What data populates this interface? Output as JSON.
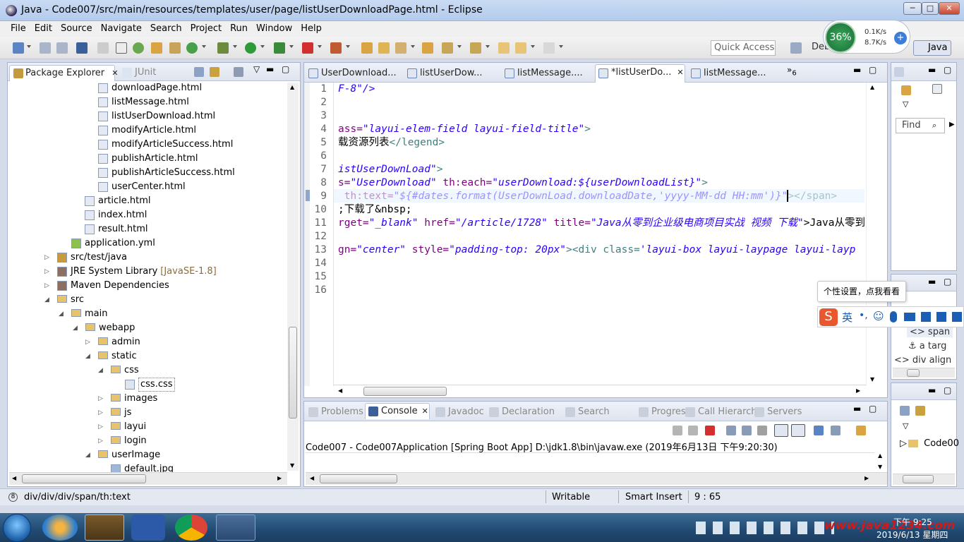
{
  "window": {
    "title": "Java - Code007/src/main/resources/templates/user/page/listUserDownloadPage.html - Eclipse",
    "buttons": [
      "─",
      "□",
      "✕"
    ]
  },
  "menu": [
    "File",
    "Edit",
    "Source",
    "Navigate",
    "Search",
    "Project",
    "Run",
    "Window",
    "Help"
  ],
  "toolbar": {
    "quick_access": "Quick Access",
    "perspective_java": "Java",
    "perspective_debug": "Debug",
    "net_meter": {
      "percent": "36%",
      "up": "0.1K/s",
      "down": "8.7K/s"
    }
  },
  "package_explorer": {
    "tab_label": "Package Explorer",
    "junit_tab": "JUnit",
    "items": [
      {
        "label": "downloadPage.html"
      },
      {
        "label": "listMessage.html"
      },
      {
        "label": "listUserDownload.html"
      },
      {
        "label": "modifyArticle.html"
      },
      {
        "label": "modifyArticleSuccess.html"
      },
      {
        "label": "publishArticle.html"
      },
      {
        "label": "publishArticleSuccess.html"
      },
      {
        "label": "userCenter.html"
      },
      {
        "label": "article.html"
      },
      {
        "label": "index.html"
      },
      {
        "label": "result.html"
      },
      {
        "label": "application.yml"
      },
      {
        "label": "src/test/java"
      },
      {
        "label": "JRE System Library",
        "suffix": "[JavaSE-1.8]"
      },
      {
        "label": "Maven Dependencies"
      },
      {
        "label": "src"
      },
      {
        "label": "main"
      },
      {
        "label": "webapp"
      },
      {
        "label": "admin"
      },
      {
        "label": "static"
      },
      {
        "label": "css"
      },
      {
        "label": "css.css"
      },
      {
        "label": "images"
      },
      {
        "label": "js"
      },
      {
        "label": "layui"
      },
      {
        "label": "login"
      },
      {
        "label": "userImage"
      },
      {
        "label": "default.jpg"
      }
    ]
  },
  "editor": {
    "tabs": [
      "UserDownload...",
      "listUserDow...",
      "listMessage....",
      "*listUserDo...",
      "listMessage..."
    ],
    "overflow_count": "6",
    "line_numbers": [
      "1",
      "2",
      "3",
      "4",
      "5",
      "6",
      "7",
      "8",
      "9",
      "10",
      "11",
      "12",
      "13",
      "14",
      "15",
      "16"
    ],
    "lines": [
      [
        {
          "t": "F-8\"/>",
          "c": "str"
        }
      ],
      [],
      [],
      [
        {
          "t": "ass=",
          "c": "attr"
        },
        {
          "t": "\"layui-elem-field layui-field-title\"",
          "c": "str"
        },
        {
          "t": ">",
          "c": "tag"
        }
      ],
      [
        {
          "t": "载资源列表",
          "c": "plain"
        },
        {
          "t": "</legend>",
          "c": "tag"
        }
      ],
      [],
      [
        {
          "t": "istUserDownLoad\"",
          "c": "str"
        },
        {
          "t": ">",
          "c": "tag"
        }
      ],
      [
        {
          "t": "s=",
          "c": "attr"
        },
        {
          "t": "\"UserDownload\"",
          "c": "str"
        },
        {
          "t": " th:each=",
          "c": "attr"
        },
        {
          "t": "\"userDownload:${userDownloadList}\"",
          "c": "str"
        },
        {
          "t": ">",
          "c": "tag"
        }
      ],
      [
        {
          "t": " th:text=",
          "c": "attr"
        },
        {
          "t": "\"${#dates.format(UserDownLoad.downloadDate,'yyyy-MM-dd HH:mm')}\"",
          "c": "str"
        },
        {
          "t": "></",
          "c": "tag"
        },
        {
          "t": "span",
          "c": "tag"
        },
        {
          "t": ">",
          "c": "tag"
        }
      ],
      [
        {
          "t": ";下载了&nbsp;",
          "c": "plain"
        }
      ],
      [
        {
          "t": "rget=",
          "c": "attr"
        },
        {
          "t": "\"_blank\"",
          "c": "str"
        },
        {
          "t": " href=",
          "c": "attr"
        },
        {
          "t": "\"/article/1728\"",
          "c": "str"
        },
        {
          "t": " title=",
          "c": "attr"
        },
        {
          "t": "\"Java从零到企业级电商项目实战 视频 下载\"",
          "c": "str"
        },
        {
          "t": ">Java从零到企业级电",
          "c": "plain"
        }
      ],
      [],
      [
        {
          "t": "gn=",
          "c": "attr"
        },
        {
          "t": "\"center\"",
          "c": "str"
        },
        {
          "t": " style=",
          "c": "attr"
        },
        {
          "t": "\"padding-top: 20px\"",
          "c": "str"
        },
        {
          "t": "><div class=",
          "c": "tag"
        },
        {
          "t": "'layui-box layui-laypage layui-layp",
          "c": "str"
        }
      ],
      [],
      [],
      []
    ]
  },
  "right_panel": {
    "find_placeholder": "Find",
    "outline_items": [
      "span",
      "a targ",
      "div align"
    ],
    "bottom_item": "Code00"
  },
  "console": {
    "tabs": [
      "Problems",
      "Console",
      "Javadoc",
      "Declaration",
      "Search",
      "Progress",
      "Call Hierarchy",
      "Servers"
    ],
    "header": "Code007 - Code007Application [Spring Boot App] D:\\jdk1.8\\bin\\javaw.exe (2019年6月13日 下午9:20:30)"
  },
  "ime_bar": {
    "tooltip": "个性设置，点我看看",
    "lang": "英"
  },
  "status": {
    "path": "div/div/div/span/th:text",
    "writable": "Writable",
    "insert_mode": "Smart Insert",
    "position": "9 : 65"
  },
  "taskbar": {
    "time": "下午 9:25",
    "date": "2019/6/13 星期四",
    "watermark": "www.java1234.com"
  }
}
